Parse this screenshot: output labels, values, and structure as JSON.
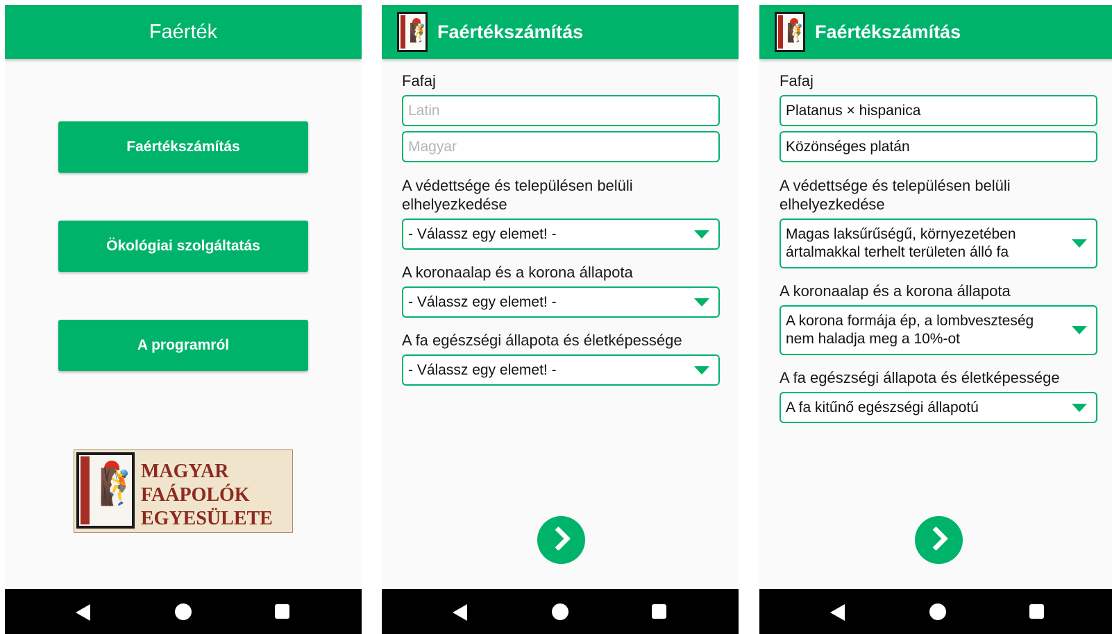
{
  "screens": [
    {
      "appbar": {
        "title": "Faérték"
      },
      "menu": {
        "buttons": [
          "Faértékszámítás",
          "Ökológiai szolgáltatás",
          "A programról"
        ]
      },
      "logo": {
        "line1": "MAGYAR",
        "line2": "FAÁPOLÓK",
        "line3": "EGYESÜLETE",
        "stripe_text": "MAGYAR FAÁPOLÓK EGYESÜLETE"
      }
    },
    {
      "appbar": {
        "title": "Faértékszámítás"
      },
      "form": {
        "fafaj_label": "Fafaj",
        "latin_placeholder": "Latin",
        "magyar_placeholder": "Magyar",
        "vedettseg_label": "A védettsége és településen belüli elhelyezkedése",
        "vedettseg_value": "- Válassz egy elemet! -",
        "korona_label": "A koronaalap és a korona állapota",
        "korona_value": "- Válassz egy elemet! -",
        "egeszseg_label": "A fa egészségi állapota és életképessége",
        "egeszseg_value": "- Válassz egy elemet! -"
      }
    },
    {
      "appbar": {
        "title": "Faértékszámítás"
      },
      "form": {
        "fafaj_label": "Fafaj",
        "latin_value": "Platanus × hispanica",
        "magyar_value": "Közönséges platán",
        "vedettseg_label": "A védettsége és településen belüli elhelyezkedése",
        "vedettseg_value": "Magas laksűrűségű, környezetében ártalmakkal terhelt területen álló fa",
        "korona_label": "A koronaalap és a korona állapota",
        "korona_value": "A korona formája ép, a lombveszteség nem haladja meg a 10%-ot",
        "egeszseg_label": "A fa egészségi állapota és életképessége",
        "egeszseg_value": "A fa kitűnő egészségi állapotú"
      }
    }
  ],
  "colors": {
    "primary": "#00b36b",
    "background": "#fafafa",
    "navbar": "#000000",
    "logo_red": "#8d2a20"
  },
  "icons": {
    "next": "chevron-right-icon",
    "back": "nav-back-icon",
    "home": "nav-home-icon",
    "recent": "nav-recents-icon"
  }
}
